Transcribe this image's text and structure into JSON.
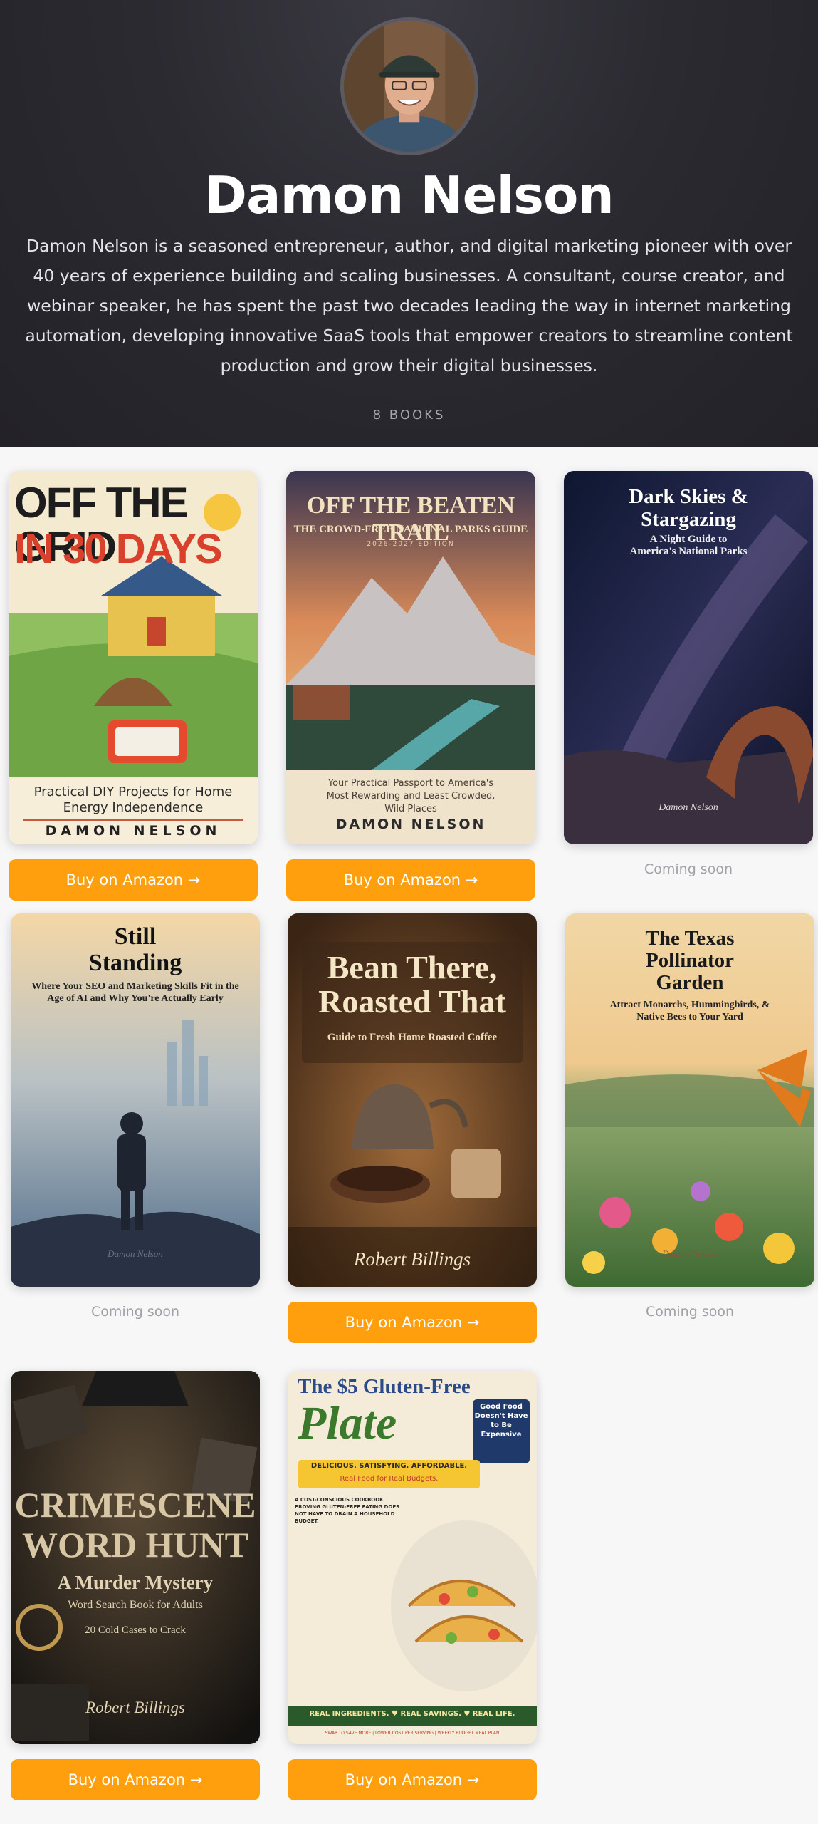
{
  "author": {
    "name": "Damon Nelson",
    "bio": "Damon Nelson is a seasoned entrepreneur, author, and digital marketing pioneer with over 40 years of experience building and scaling businesses. A consultant, course creator, and webinar speaker, he has spent the past two decades leading the way in internet marketing automation, developing innovative SaaS tools that empower creators to streamline content production and grow their digital businesses.",
    "book_count": "8 BOOKS"
  },
  "buy_label": "Buy on Amazon →",
  "coming_soon_label": "Coming soon",
  "books": [
    {
      "title_l1": "OFF THE GRID",
      "title_l2": "IN 30 DAYS",
      "subtitle": "Practical DIY Projects for Home Energy Independence",
      "author": "DAMON NELSON",
      "status": "buy"
    },
    {
      "title": "OFF THE BEATEN TRAIL",
      "subtitle": "THE CROWD-FREE NATIONAL PARKS GUIDE",
      "edition": "2026-2027 EDITION",
      "tagline": "Your Practical Passport to America's Most Rewarding and Least Crowded, Wild Places",
      "author": "DAMON NELSON",
      "status": "buy"
    },
    {
      "title": "Dark Skies & Stargazing",
      "subtitle": "A Night Guide to America's National Parks",
      "author": "Damon Nelson",
      "status": "soon"
    },
    {
      "title": "Still Standing",
      "subtitle": "Where Your SEO and Marketing Skills Fit in the Age of AI and Why You're Actually Early",
      "author": "Damon Nelson",
      "status": "soon"
    },
    {
      "title": "Bean There, Roasted That",
      "subtitle": "Guide to Fresh Home Roasted Coffee",
      "author": "Robert Billings",
      "status": "buy"
    },
    {
      "title": "The Texas Pollinator Garden",
      "subtitle": "Attract Monarchs, Hummingbirds, & Native Bees to Your Yard",
      "author": "Damon Nelson",
      "status": "soon"
    },
    {
      "title_l1": "CRIMESCENE",
      "title_l2": "WORD HUNT",
      "subtitle": "A Murder Mystery",
      "subtitle2": "Word Search Book for Adults",
      "tagline": "20 Cold Cases to Crack",
      "author": "Robert Billings",
      "status": "buy"
    },
    {
      "title_l1": "The $5 Gluten-Free",
      "title_l2": "Plate",
      "subtitle": "DELICIOUS. SATISFYING. AFFORDABLE.",
      "subtitle2": "Real Food for Real Budgets.",
      "badge": "Good Food Doesn't Have to Be Expensive",
      "blurb": "A COST-CONSCIOUS COOKBOOK PROVING GLUTEN-FREE EATING DOES NOT HAVE TO DRAIN A HOUSEHOLD BUDGET.",
      "footer": "REAL INGREDIENTS. ♥ REAL SAVINGS. ♥ REAL LIFE.",
      "footer2": "SWAP TO SAVE MORE | LOWER COST PER SERVING | WEEKLY BUDGET MEAL PLAN",
      "status": "buy"
    }
  ]
}
